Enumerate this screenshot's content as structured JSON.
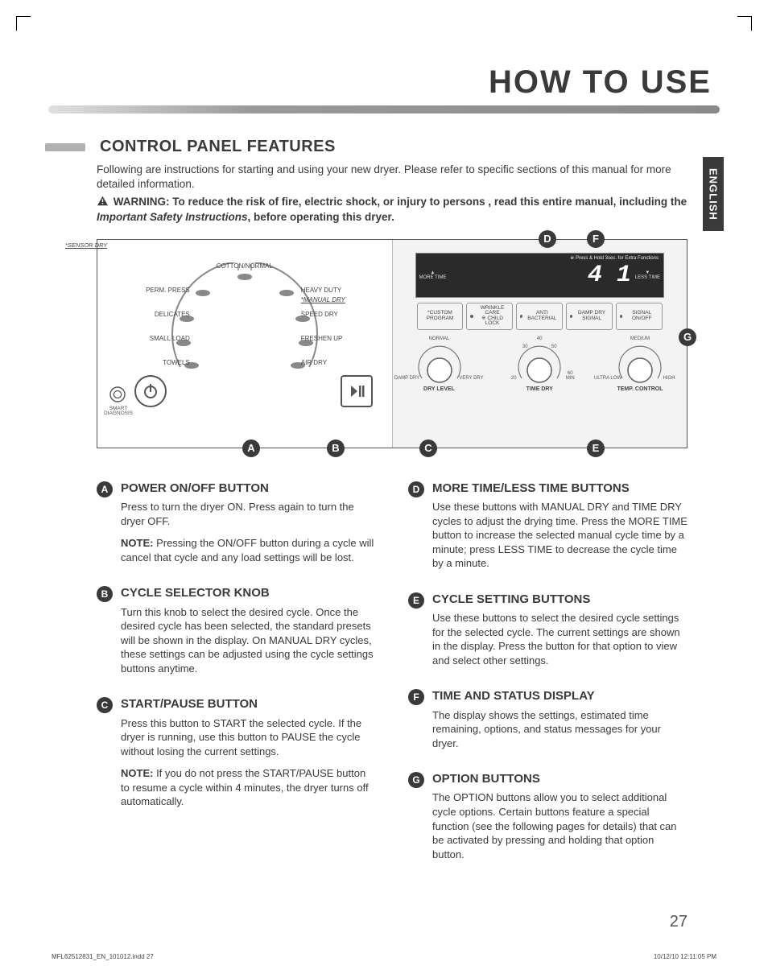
{
  "header": {
    "title": "HOW TO USE",
    "language_tab": "ENGLISH"
  },
  "section": {
    "heading": "CONTROL PANEL FEATURES",
    "intro": "Following are instructions for starting and using your new dryer. Please refer to specific sections of this manual for more detailed information.",
    "warning_prefix": "WARNING: To reduce the risk of fire, electric shock, or injury to persons , read this entire manual, including the ",
    "warning_italic": "Important Safety Instructions",
    "warning_suffix": ", before operating this dryer."
  },
  "panel": {
    "sensor_dry_label": "*SENSOR DRY",
    "manual_dry_label": "*MANUAL DRY",
    "dial_top": "COTTON/NORMAL",
    "dial": {
      "perm_press": "PERM. PRESS",
      "heavy_duty": "HEAVY DUTY",
      "delicates": "DELICATES",
      "speed_dry": "SPEED DRY",
      "small_load": "SMALL LOAD",
      "freshen_up": "FRESHEN UP",
      "towels": "TOWELS",
      "air_dry": "AIR DRY"
    },
    "diag_label": "SMART DIAGNOSIS",
    "display": {
      "more_time": "MORE TIME",
      "less_time": "LESS TIME",
      "digits": "4 1",
      "hint": "※ Press & Hold 3sec. for Extra Functions"
    },
    "options": {
      "custom": "*CUSTOM PROGRAM",
      "wrinkle": "WRINKLE CARE",
      "child_lock": "※ CHILD LOCK",
      "anti": "ANTI BACTERIAL",
      "damp": "DAMP DRY SIGNAL",
      "signal": "SIGNAL ON/OFF"
    },
    "knobs": {
      "dry_level": {
        "title": "DRY LEVEL",
        "left": "DAMP DRY",
        "mid": "NORMAL",
        "right": "VERY DRY"
      },
      "time_dry": {
        "title": "TIME DRY",
        "t20": "20",
        "t30": "30",
        "t40": "40",
        "t50": "50",
        "t60": "60",
        "unit": "MIN"
      },
      "temp": {
        "title": "TEMP. CONTROL",
        "left": "ULTRA LOW",
        "mid": "MEDIUM",
        "right": "HIGH"
      }
    },
    "callouts": {
      "A": "A",
      "B": "B",
      "C": "C",
      "D": "D",
      "E": "E",
      "F": "F",
      "G": "G"
    }
  },
  "features": {
    "left": [
      {
        "id": "A",
        "title": "POWER ON/OFF BUTTON",
        "paras": [
          "Press to turn the dryer ON. Press again to turn the dryer OFF."
        ],
        "note": "Pressing the ON/OFF button during a cycle will cancel that cycle and any load settings will be lost."
      },
      {
        "id": "B",
        "title": "CYCLE SELECTOR KNOB",
        "paras": [
          "Turn this knob to select the desired cycle. Once the desired cycle has been selected, the standard presets will be shown in the display. On MANUAL DRY cycles, these settings can be adjusted using the cycle settings buttons anytime."
        ]
      },
      {
        "id": "C",
        "title": "START/PAUSE BUTTON",
        "paras": [
          "Press this button to START the selected cycle. If the dryer is running, use this button to PAUSE the cycle without losing the current settings."
        ],
        "note": "If you do not press the START/PAUSE button to resume a cycle within 4 minutes, the dryer turns off automatically."
      }
    ],
    "right": [
      {
        "id": "D",
        "title": "MORE TIME/LESS TIME BUTTONS",
        "paras": [
          "Use these buttons with MANUAL DRY and TIME DRY cycles to adjust the drying time. Press the MORE TIME button to increase the selected manual cycle time by a minute; press LESS TIME to decrease the cycle time by a minute."
        ]
      },
      {
        "id": "E",
        "title": "CYCLE SETTING BUTTONS",
        "paras": [
          "Use these buttons to select the desired cycle settings for the selected cycle. The current settings are shown in the display. Press the button for that option to view and select other settings."
        ]
      },
      {
        "id": "F",
        "title": "TIME AND STATUS DISPLAY",
        "paras": [
          "The display shows the settings, estimated time remaining, options, and status messages for your dryer."
        ]
      },
      {
        "id": "G",
        "title": "OPTION BUTTONS",
        "paras": [
          "The OPTION buttons allow you to select additional cycle options. Certain buttons feature a special function (see the following pages for details) that can be activated by pressing and holding that option button."
        ]
      }
    ]
  },
  "footer": {
    "page_num": "27",
    "left": "MFL62512831_EN_101012.indd   27",
    "right": "10/12/10   12:11:05 PM"
  },
  "note_label": "NOTE:"
}
